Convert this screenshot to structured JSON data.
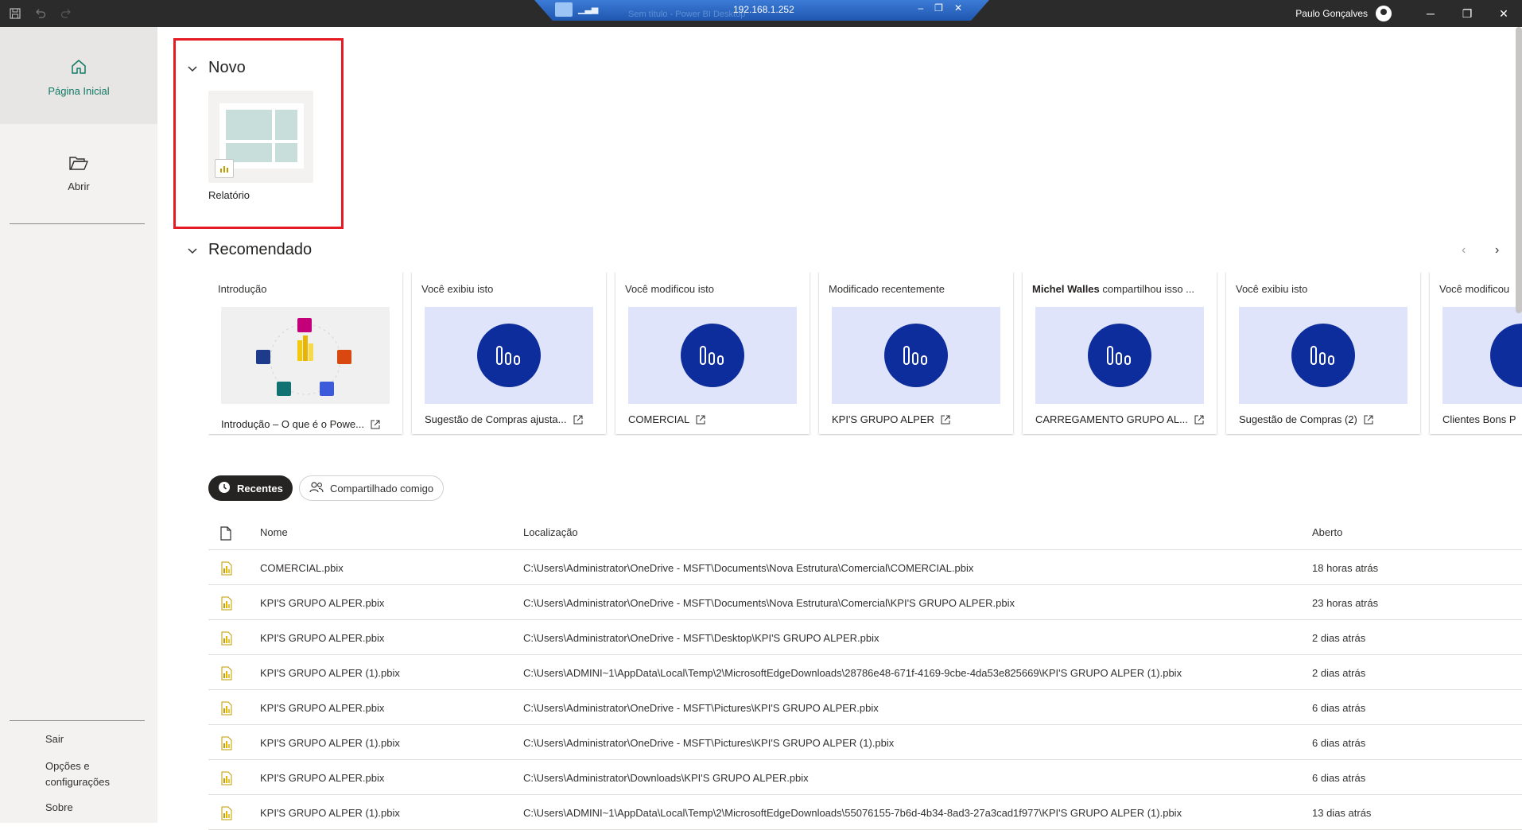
{
  "window": {
    "remote_host": "192.168.1.252",
    "remote_title_faded": "Sem título - Power BI Desktop",
    "user_name": "Paulo Gonçalves"
  },
  "sidebar": {
    "home_label": "Página Inicial",
    "open_label": "Abrir",
    "bottom": [
      "Sair",
      "Opções e",
      "configurações",
      "Sobre"
    ]
  },
  "new_section": {
    "title": "Novo",
    "tile_label": "Relatório"
  },
  "recommended": {
    "title": "Recomendado",
    "cards": [
      {
        "head": "Introdução",
        "foot": "Introdução – O que é o Powe..."
      },
      {
        "head": "Você exibiu isto",
        "foot": "Sugestão de Compras ajusta..."
      },
      {
        "head": "Você modificou isto",
        "foot": "COMERCIAL"
      },
      {
        "head": "Modificado recentemente",
        "foot": "KPI'S GRUPO ALPER"
      },
      {
        "head_bold": "Michel Walles",
        "head": " compartilhou isso ...",
        "foot": "CARREGAMENTO GRUPO AL..."
      },
      {
        "head": "Você exibiu isto",
        "foot": "Sugestão de Compras (2)"
      },
      {
        "head": "Você modificou",
        "foot": "Clientes Bons P"
      }
    ]
  },
  "tabs": {
    "recent": "Recentes",
    "shared": "Compartilhado comigo"
  },
  "table": {
    "headers": {
      "name": "Nome",
      "location": "Localização",
      "opened": "Aberto"
    },
    "rows": [
      {
        "name": "COMERCIAL.pbix",
        "location": "C:\\Users\\Administrator\\OneDrive - MSFT\\Documents\\Nova Estrutura\\Comercial\\COMERCIAL.pbix",
        "opened": "18 horas atrás"
      },
      {
        "name": "KPI'S GRUPO ALPER.pbix",
        "location": "C:\\Users\\Administrator\\OneDrive - MSFT\\Documents\\Nova Estrutura\\Comercial\\KPI'S GRUPO ALPER.pbix",
        "opened": "23 horas atrás"
      },
      {
        "name": "KPI'S GRUPO ALPER.pbix",
        "location": "C:\\Users\\Administrator\\OneDrive - MSFT\\Desktop\\KPI'S GRUPO ALPER.pbix",
        "opened": "2 dias atrás"
      },
      {
        "name": "KPI'S GRUPO ALPER (1).pbix",
        "location": "C:\\Users\\ADMINI~1\\AppData\\Local\\Temp\\2\\MicrosoftEdgeDownloads\\28786e48-671f-4169-9cbe-4da53e825669\\KPI'S GRUPO ALPER (1).pbix",
        "opened": "2 dias atrás"
      },
      {
        "name": "KPI'S GRUPO ALPER.pbix",
        "location": "C:\\Users\\Administrator\\OneDrive - MSFT\\Pictures\\KPI'S GRUPO ALPER.pbix",
        "opened": "6 dias atrás"
      },
      {
        "name": "KPI'S GRUPO ALPER (1).pbix",
        "location": "C:\\Users\\Administrator\\OneDrive - MSFT\\Pictures\\KPI'S GRUPO ALPER (1).pbix",
        "opened": "6 dias atrás"
      },
      {
        "name": "KPI'S GRUPO ALPER.pbix",
        "location": "C:\\Users\\Administrator\\Downloads\\KPI'S GRUPO ALPER.pbix",
        "opened": "6 dias atrás"
      },
      {
        "name": "KPI'S GRUPO ALPER (1).pbix",
        "location": "C:\\Users\\ADMINI~1\\AppData\\Local\\Temp\\2\\MicrosoftEdgeDownloads\\55076155-7b6d-4b34-8ad3-27a3cad1f977\\KPI'S GRUPO ALPER (1).pbix",
        "opened": "13 dias atrás"
      }
    ]
  },
  "colors": {
    "accent": "#117865",
    "highlight": "#e41b23",
    "report_circle": "#0e2d9c",
    "report_bg": "#dfe4fb"
  }
}
